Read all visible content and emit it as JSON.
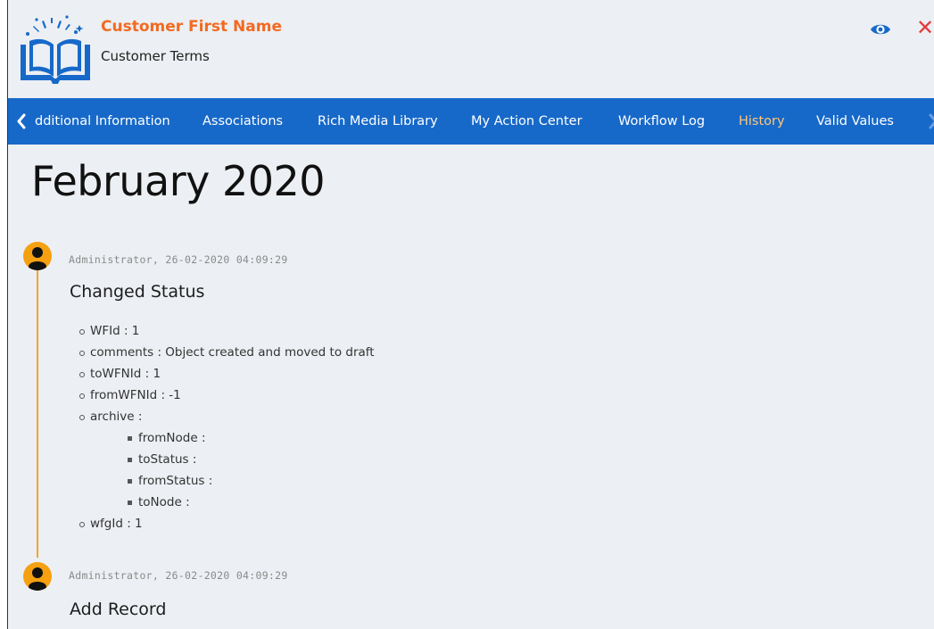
{
  "header": {
    "title": "Customer First Name",
    "subtitle": "Customer Terms",
    "logo_icon": "open-book-icon",
    "view_icon": "eye-icon",
    "close_label": "✕"
  },
  "tabs": [
    {
      "label": "dditional Information",
      "active": false
    },
    {
      "label": "Associations",
      "active": false
    },
    {
      "label": "Rich Media Library",
      "active": false
    },
    {
      "label": "My Action Center",
      "active": false
    },
    {
      "label": "Workflow Log",
      "active": false
    },
    {
      "label": "History",
      "active": true
    },
    {
      "label": "Valid Values",
      "active": false
    }
  ],
  "history": {
    "month": "February 2020",
    "entries": [
      {
        "meta": "Administrator, 26-02-2020 04:09:29",
        "action": "Changed Status",
        "details": [
          "WFId : 1",
          "comments : Object created and moved to draft",
          "toWFNId : 1",
          "fromWFNId : -1",
          "archive :",
          "fromNode :",
          "toStatus :",
          "fromStatus :",
          "toNode :",
          "wfgId : 1"
        ]
      },
      {
        "meta": "Administrator, 26-02-2020 04:09:29",
        "action": "Add Record"
      }
    ]
  },
  "colors": {
    "accent_orange": "#f26a21",
    "tab_bar_blue": "#1769c9",
    "active_tab": "#ffc879",
    "timeline": "#f5a623",
    "close_red": "#e23b3b"
  }
}
